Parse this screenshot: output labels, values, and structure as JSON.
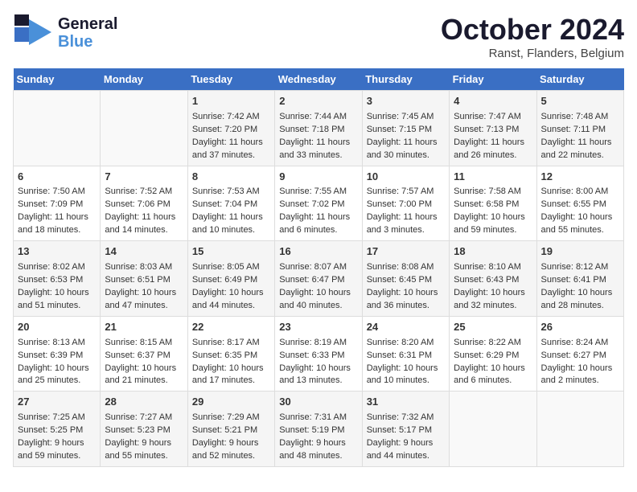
{
  "header": {
    "logo_general": "General",
    "logo_blue": "Blue",
    "month_title": "October 2024",
    "location": "Ranst, Flanders, Belgium"
  },
  "calendar": {
    "days_of_week": [
      "Sunday",
      "Monday",
      "Tuesday",
      "Wednesday",
      "Thursday",
      "Friday",
      "Saturday"
    ],
    "weeks": [
      [
        {
          "day": "",
          "sunrise": "",
          "sunset": "",
          "daylight": ""
        },
        {
          "day": "",
          "sunrise": "",
          "sunset": "",
          "daylight": ""
        },
        {
          "day": "1",
          "sunrise": "Sunrise: 7:42 AM",
          "sunset": "Sunset: 7:20 PM",
          "daylight": "Daylight: 11 hours and 37 minutes."
        },
        {
          "day": "2",
          "sunrise": "Sunrise: 7:44 AM",
          "sunset": "Sunset: 7:18 PM",
          "daylight": "Daylight: 11 hours and 33 minutes."
        },
        {
          "day": "3",
          "sunrise": "Sunrise: 7:45 AM",
          "sunset": "Sunset: 7:15 PM",
          "daylight": "Daylight: 11 hours and 30 minutes."
        },
        {
          "day": "4",
          "sunrise": "Sunrise: 7:47 AM",
          "sunset": "Sunset: 7:13 PM",
          "daylight": "Daylight: 11 hours and 26 minutes."
        },
        {
          "day": "5",
          "sunrise": "Sunrise: 7:48 AM",
          "sunset": "Sunset: 7:11 PM",
          "daylight": "Daylight: 11 hours and 22 minutes."
        }
      ],
      [
        {
          "day": "6",
          "sunrise": "Sunrise: 7:50 AM",
          "sunset": "Sunset: 7:09 PM",
          "daylight": "Daylight: 11 hours and 18 minutes."
        },
        {
          "day": "7",
          "sunrise": "Sunrise: 7:52 AM",
          "sunset": "Sunset: 7:06 PM",
          "daylight": "Daylight: 11 hours and 14 minutes."
        },
        {
          "day": "8",
          "sunrise": "Sunrise: 7:53 AM",
          "sunset": "Sunset: 7:04 PM",
          "daylight": "Daylight: 11 hours and 10 minutes."
        },
        {
          "day": "9",
          "sunrise": "Sunrise: 7:55 AM",
          "sunset": "Sunset: 7:02 PM",
          "daylight": "Daylight: 11 hours and 6 minutes."
        },
        {
          "day": "10",
          "sunrise": "Sunrise: 7:57 AM",
          "sunset": "Sunset: 7:00 PM",
          "daylight": "Daylight: 11 hours and 3 minutes."
        },
        {
          "day": "11",
          "sunrise": "Sunrise: 7:58 AM",
          "sunset": "Sunset: 6:58 PM",
          "daylight": "Daylight: 10 hours and 59 minutes."
        },
        {
          "day": "12",
          "sunrise": "Sunrise: 8:00 AM",
          "sunset": "Sunset: 6:55 PM",
          "daylight": "Daylight: 10 hours and 55 minutes."
        }
      ],
      [
        {
          "day": "13",
          "sunrise": "Sunrise: 8:02 AM",
          "sunset": "Sunset: 6:53 PM",
          "daylight": "Daylight: 10 hours and 51 minutes."
        },
        {
          "day": "14",
          "sunrise": "Sunrise: 8:03 AM",
          "sunset": "Sunset: 6:51 PM",
          "daylight": "Daylight: 10 hours and 47 minutes."
        },
        {
          "day": "15",
          "sunrise": "Sunrise: 8:05 AM",
          "sunset": "Sunset: 6:49 PM",
          "daylight": "Daylight: 10 hours and 44 minutes."
        },
        {
          "day": "16",
          "sunrise": "Sunrise: 8:07 AM",
          "sunset": "Sunset: 6:47 PM",
          "daylight": "Daylight: 10 hours and 40 minutes."
        },
        {
          "day": "17",
          "sunrise": "Sunrise: 8:08 AM",
          "sunset": "Sunset: 6:45 PM",
          "daylight": "Daylight: 10 hours and 36 minutes."
        },
        {
          "day": "18",
          "sunrise": "Sunrise: 8:10 AM",
          "sunset": "Sunset: 6:43 PM",
          "daylight": "Daylight: 10 hours and 32 minutes."
        },
        {
          "day": "19",
          "sunrise": "Sunrise: 8:12 AM",
          "sunset": "Sunset: 6:41 PM",
          "daylight": "Daylight: 10 hours and 28 minutes."
        }
      ],
      [
        {
          "day": "20",
          "sunrise": "Sunrise: 8:13 AM",
          "sunset": "Sunset: 6:39 PM",
          "daylight": "Daylight: 10 hours and 25 minutes."
        },
        {
          "day": "21",
          "sunrise": "Sunrise: 8:15 AM",
          "sunset": "Sunset: 6:37 PM",
          "daylight": "Daylight: 10 hours and 21 minutes."
        },
        {
          "day": "22",
          "sunrise": "Sunrise: 8:17 AM",
          "sunset": "Sunset: 6:35 PM",
          "daylight": "Daylight: 10 hours and 17 minutes."
        },
        {
          "day": "23",
          "sunrise": "Sunrise: 8:19 AM",
          "sunset": "Sunset: 6:33 PM",
          "daylight": "Daylight: 10 hours and 13 minutes."
        },
        {
          "day": "24",
          "sunrise": "Sunrise: 8:20 AM",
          "sunset": "Sunset: 6:31 PM",
          "daylight": "Daylight: 10 hours and 10 minutes."
        },
        {
          "day": "25",
          "sunrise": "Sunrise: 8:22 AM",
          "sunset": "Sunset: 6:29 PM",
          "daylight": "Daylight: 10 hours and 6 minutes."
        },
        {
          "day": "26",
          "sunrise": "Sunrise: 8:24 AM",
          "sunset": "Sunset: 6:27 PM",
          "daylight": "Daylight: 10 hours and 2 minutes."
        }
      ],
      [
        {
          "day": "27",
          "sunrise": "Sunrise: 7:25 AM",
          "sunset": "Sunset: 5:25 PM",
          "daylight": "Daylight: 9 hours and 59 minutes."
        },
        {
          "day": "28",
          "sunrise": "Sunrise: 7:27 AM",
          "sunset": "Sunset: 5:23 PM",
          "daylight": "Daylight: 9 hours and 55 minutes."
        },
        {
          "day": "29",
          "sunrise": "Sunrise: 7:29 AM",
          "sunset": "Sunset: 5:21 PM",
          "daylight": "Daylight: 9 hours and 52 minutes."
        },
        {
          "day": "30",
          "sunrise": "Sunrise: 7:31 AM",
          "sunset": "Sunset: 5:19 PM",
          "daylight": "Daylight: 9 hours and 48 minutes."
        },
        {
          "day": "31",
          "sunrise": "Sunrise: 7:32 AM",
          "sunset": "Sunset: 5:17 PM",
          "daylight": "Daylight: 9 hours and 44 minutes."
        },
        {
          "day": "",
          "sunrise": "",
          "sunset": "",
          "daylight": ""
        },
        {
          "day": "",
          "sunrise": "",
          "sunset": "",
          "daylight": ""
        }
      ]
    ]
  }
}
